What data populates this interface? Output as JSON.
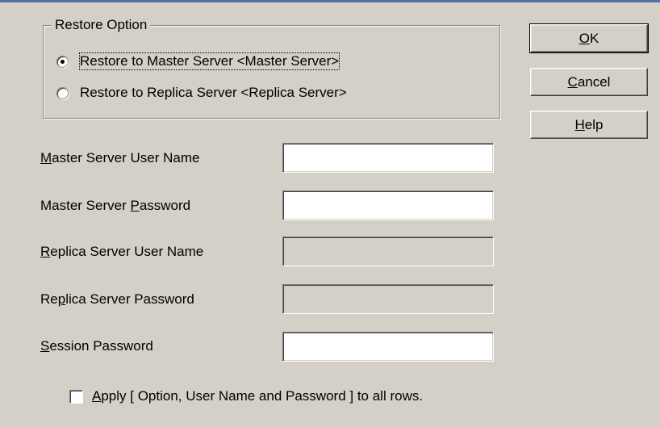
{
  "restore_option": {
    "legend": "Restore Option",
    "options": [
      {
        "label": "Restore to Master Server <Master Server>",
        "selected": true
      },
      {
        "label": "Restore to Replica Server <Replica Server>",
        "selected": false
      }
    ]
  },
  "buttons": {
    "ok": {
      "mnemonic": "O",
      "rest": "K"
    },
    "cancel": {
      "mnemonic": "C",
      "rest": "ancel"
    },
    "help": {
      "mnemonic": "H",
      "rest": "elp"
    }
  },
  "fields": {
    "master_user": {
      "pre": "",
      "mnemonic": "M",
      "post": "aster Server User Name",
      "value": "",
      "enabled": true
    },
    "master_password": {
      "pre": "Master Server ",
      "mnemonic": "P",
      "post": "assword",
      "value": "",
      "enabled": true
    },
    "replica_user": {
      "pre": "",
      "mnemonic": "R",
      "post": "eplica Server User Name",
      "value": "",
      "enabled": false
    },
    "replica_password": {
      "pre": "Re",
      "mnemonic": "p",
      "post": "lica Server Password",
      "value": "",
      "enabled": false
    },
    "session_password": {
      "pre": "",
      "mnemonic": "S",
      "post": "ession Password",
      "value": "",
      "enabled": true
    }
  },
  "apply_all": {
    "mnemonic": "A",
    "rest": "pply [ Option, User Name and Password ] to all rows.",
    "checked": false
  },
  "colors": {
    "dialog_background": "#d4d0c8",
    "field_background": "#ffffff",
    "title_bar_accent": "#4f6fa8"
  }
}
